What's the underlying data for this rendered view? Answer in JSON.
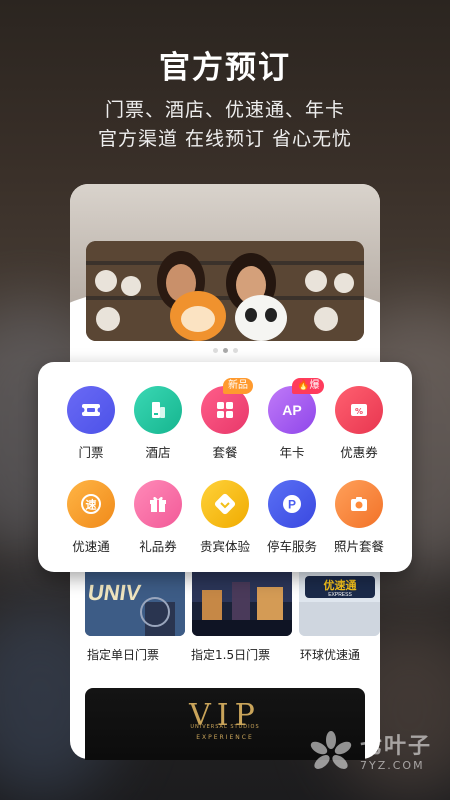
{
  "hero": {
    "title": "官方预订",
    "subtitle_line1": "门票、酒店、优速通、年卡",
    "subtitle_line2": "官方渠道 在线预订 省心无忧"
  },
  "services": [
    {
      "label": "门票",
      "icon": "ticket-icon",
      "color": "#5b5ff0"
    },
    {
      "label": "酒店",
      "icon": "hotel-icon",
      "color": "#1fc4a0"
    },
    {
      "label": "套餐",
      "icon": "package-icon",
      "color": "#f0467a",
      "tag": "新品"
    },
    {
      "label": "年卡",
      "icon": "annual-pass-icon",
      "color": "#a45cf0",
      "tag": "爆"
    },
    {
      "label": "优惠券",
      "icon": "coupon-icon",
      "color": "#f04a63"
    },
    {
      "label": "优速通",
      "icon": "express-icon",
      "color": "#f7a12a"
    },
    {
      "label": "礼品券",
      "icon": "gift-icon",
      "color": "#ff6ba3"
    },
    {
      "label": "贵宾体验",
      "icon": "vip-diamond-icon",
      "color": "#f2bf18"
    },
    {
      "label": "停车服务",
      "icon": "parking-icon",
      "color": "#4a5df0"
    },
    {
      "label": "照片套餐",
      "icon": "camera-icon",
      "color": "#ff8a3a"
    }
  ],
  "icon_texts": {
    "ticket": "",
    "express": "速",
    "annual_pass": "AP",
    "parking": "P"
  },
  "tiles": [
    {
      "label": "指定单日门票"
    },
    {
      "label": "指定1.5日门票"
    },
    {
      "label": "环球优速通"
    }
  ],
  "tile_signs": {
    "univ": "UNIV",
    "express_cn": "优速通",
    "express_en": "EXPRESS"
  },
  "vip_banner": {
    "logo": "VIP",
    "brand": "UNIVERSAL STUDIOS",
    "sub": "EXPERIENCE"
  },
  "watermark": {
    "cn": "七叶子",
    "en": "7YZ.COM"
  }
}
